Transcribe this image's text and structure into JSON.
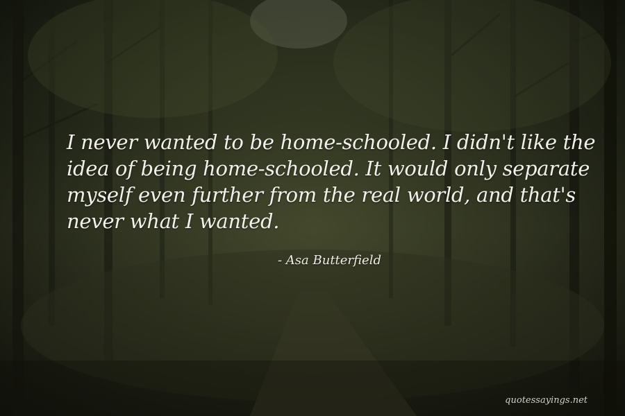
{
  "quote": {
    "lines": [
      "I never wanted to be home-schooled. I didn't like the",
      "idea of being home-schooled. It would only separate",
      "myself even further from the real world, and that's",
      "never what I wanted."
    ],
    "author": "- Asa Butterfield"
  },
  "watermark": "quotessayings.net",
  "colors": {
    "text": "#f2f0ea",
    "background": "#2e3320"
  }
}
